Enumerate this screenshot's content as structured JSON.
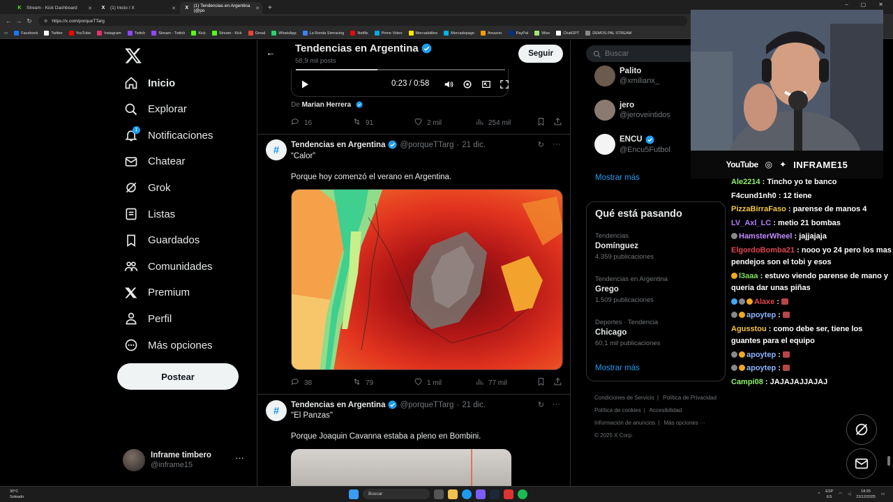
{
  "browser": {
    "tabs": [
      {
        "title": "Stream - Kick Dashboard",
        "icon": "kick-icon",
        "color": "#53fc18",
        "active": false
      },
      {
        "title": "(1) Inicio / X",
        "icon": "x-icon",
        "color": "#ffffff",
        "active": false
      },
      {
        "title": "(1) Tendencias en Argentina (@po",
        "icon": "x-icon",
        "color": "#ffffff",
        "active": true
      }
    ],
    "new_tab": "+",
    "url": "https://x.com/porqueTTarg",
    "bookmarks": [
      {
        "label": "Facebook",
        "color": "#1877f2"
      },
      {
        "label": "Twitter",
        "color": "#ffffff"
      },
      {
        "label": "YouTube",
        "color": "#ff0000"
      },
      {
        "label": "Instagram",
        "color": "#e1306c"
      },
      {
        "label": "Twitch",
        "color": "#9146ff"
      },
      {
        "label": "Stream - Twitch",
        "color": "#9146ff"
      },
      {
        "label": "Kick",
        "color": "#53fc18"
      },
      {
        "label": "Stream - Kick",
        "color": "#53fc18"
      },
      {
        "label": "Gmail",
        "color": "#ea4335"
      },
      {
        "label": "WhatsApp",
        "color": "#25d366"
      },
      {
        "label": "La Ronda Simracing",
        "color": "#3b82f6"
      },
      {
        "label": "Netflix",
        "color": "#e50914"
      },
      {
        "label": "Prime Video",
        "color": "#00a8e1"
      },
      {
        "label": "Mercadolibre",
        "color": "#ffe600"
      },
      {
        "label": "Mercadopago",
        "color": "#00b1ea"
      },
      {
        "label": "Amazon.",
        "color": "#ff9900"
      },
      {
        "label": "PayPal",
        "color": "#003087"
      },
      {
        "label": "Wise",
        "color": "#9fe870"
      },
      {
        "label": "ChatGPT",
        "color": "#ffffff"
      },
      {
        "label": "DEMOS PAL STREAM",
        "color": "#888888"
      }
    ]
  },
  "nav": {
    "items": [
      {
        "label": "Inicio",
        "icon": "home-icon"
      },
      {
        "label": "Explorar",
        "icon": "search-icon"
      },
      {
        "label": "Notificaciones",
        "icon": "bell-icon",
        "badge": "1"
      },
      {
        "label": "Chatear",
        "icon": "mail-icon"
      },
      {
        "label": "Grok",
        "icon": "grok-icon"
      },
      {
        "label": "Listas",
        "icon": "list-icon"
      },
      {
        "label": "Guardados",
        "icon": "bookmark-icon"
      },
      {
        "label": "Comunidades",
        "icon": "communities-icon"
      },
      {
        "label": "Premium",
        "icon": "x-premium-icon"
      },
      {
        "label": "Perfil",
        "icon": "person-icon"
      },
      {
        "label": "Más opciones",
        "icon": "more-circle-icon"
      }
    ],
    "post_label": "Postear",
    "profile": {
      "name": "Inframe timbero",
      "handle": "@inframe15",
      "more": "···"
    }
  },
  "header": {
    "title": "Tendencias en Argentina",
    "subtitle": "58,9 mil posts",
    "follow_label": "Seguir"
  },
  "video": {
    "time": "0:23 / 0:58",
    "progress": 0.39
  },
  "quote": {
    "from_label": "De",
    "from_name": "Marian Herrera"
  },
  "tweet0_actions": {
    "replies": "16",
    "reposts": "91",
    "likes": "2 mil",
    "views": "254 mil"
  },
  "tweet1": {
    "name": "Tendencias en Argentina",
    "handle": "@porqueTTarg",
    "dot": "·",
    "date": "21 dic.",
    "title": "“Calor”",
    "text": "Porque hoy comenzó el verano en Argentina.",
    "actions": {
      "replies": "38",
      "reposts": "79",
      "likes": "1 mil",
      "views": "77 mil"
    }
  },
  "tweet2": {
    "name": "Tendencias en Argentina",
    "handle": "@porqueTTarg",
    "dot": "·",
    "date": "21 dic.",
    "title": "\"El Panzas\"",
    "text": "Porque Joaquin Cavanna estaba a pleno en Bombini."
  },
  "right": {
    "search_placeholder": "Buscar",
    "who_to_follow": [
      {
        "name": "Palito",
        "handle": "@xmilianx_",
        "verified": false
      },
      {
        "name": "jero",
        "handle": "@jeroveintidos",
        "verified": false
      },
      {
        "name": "ENCU",
        "handle": "@Encu5Futbol",
        "verified": true
      }
    ],
    "show_more": "Mostrar más",
    "whats_happening_title": "Qué está pasando",
    "trends": [
      {
        "context": "Tendencias",
        "title": "Domínguez",
        "count": "4.359 publicaciones"
      },
      {
        "context": "Tendencias en Argentina",
        "title": "Grego",
        "count": "1.509 publicaciones"
      },
      {
        "context": "Deportes · Tendencia",
        "title": "Chicago",
        "count": "60,1 mil publicaciones"
      }
    ],
    "show_more_2": "Mostrar más",
    "footer": {
      "terms": "Condiciones de Servicio",
      "privacy": "Política de Privacidad",
      "cookies": "Política de cookies",
      "accessibility": "Accesibilidad",
      "ads": "Información de anuncios",
      "more": "Más opciones ···",
      "copyright": "© 2025 X Corp."
    }
  },
  "stream_overlay": {
    "socials": {
      "youtube": "YouTube",
      "brand": "INFRAME15"
    },
    "chat": [
      {
        "user": "Ale2214",
        "color": "#8ef26a",
        "msg": ": Tincho yo te banco",
        "badges": []
      },
      {
        "user": "F4cund1nh0",
        "color": "#ffffff",
        "msg": ": 12 tiene",
        "badges": []
      },
      {
        "user": "PizzaBirraFaso",
        "color": "#f5c542",
        "msg": ": parense de manos 4",
        "badges": []
      },
      {
        "user": "LV_Axl_LC",
        "color": "#b57cff",
        "msg": ": metio 21 bombas",
        "badges": []
      },
      {
        "user": "HamsterWheel",
        "color": "#c08cff",
        "msg": ": jajjajaja",
        "badges": [
          "#888888"
        ]
      },
      {
        "user": "ElgordoBomba21",
        "color": "#e0464e",
        "msg": ": nooo yo 24 pero los mas pendejos son el tobi y esos",
        "badges": []
      },
      {
        "user": "l3aaa",
        "color": "#7fe05a",
        "msg": ": estuvo viendo parense de mano y queria dar unas piñas",
        "badges": [
          "#f2a81d"
        ]
      },
      {
        "user": "Alaxe",
        "color": "#e0464e",
        "msg": ":",
        "badges": [
          "#3fa9f5",
          "#888888",
          "#f2a81d"
        ],
        "emote": true
      },
      {
        "user": "apoytep",
        "color": "#8ab4ff",
        "msg": ":",
        "badges": [
          "#888888",
          "#f2a81d"
        ],
        "emote": true
      },
      {
        "user": "Agusstou",
        "color": "#f5c542",
        "msg": ": como debe ser, tiene los guantes para el equipo",
        "badges": []
      },
      {
        "user": "apoytep",
        "color": "#8ab4ff",
        "msg": ":",
        "badges": [
          "#888888",
          "#f2a81d"
        ],
        "emote": true
      },
      {
        "user": "apoytep",
        "color": "#8ab4ff",
        "msg": ":",
        "badges": [
          "#888888",
          "#f2a81d"
        ],
        "emote": true
      },
      {
        "user": "Campi08",
        "color": "#8ef26a",
        "msg": ": JAJAJAJJAJAJ",
        "badges": []
      }
    ]
  },
  "taskbar": {
    "weather_temp": "30°C",
    "weather_desc": "Soleado",
    "search_label": "Buscar",
    "lang_top": "ESP",
    "lang_bottom": "ES",
    "time": "18:25",
    "date": "22/12/2025"
  },
  "colors": {
    "accent": "#1d9bf0",
    "verified": "#1d9bf0",
    "bg": "#000000",
    "text": "#e7e9ea",
    "muted": "#71767b"
  }
}
